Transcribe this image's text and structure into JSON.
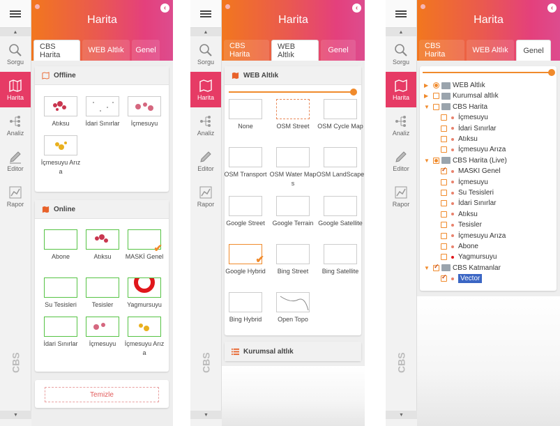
{
  "app": {
    "title": "Harita",
    "cbs_label": "CBS"
  },
  "sidebar": {
    "items": [
      {
        "label": "Sorgu",
        "icon": "search-icon"
      },
      {
        "label": "Harita",
        "icon": "map-icon"
      },
      {
        "label": "Analiz",
        "icon": "analysis-icon"
      },
      {
        "label": "Editor",
        "icon": "pencil-icon"
      },
      {
        "label": "Rapor",
        "icon": "chart-icon"
      }
    ]
  },
  "tabs": [
    "CBS Harita",
    "WEB Altlık",
    "Genel"
  ],
  "panel1": {
    "offline_title": "Offline",
    "offline_layers": [
      "Atıksu",
      "İdari Sınırlar",
      "İçmesuyu",
      "İçmesuyu Arıza"
    ],
    "online_title": "Online",
    "online_layers": [
      "Abone",
      "Atıksu",
      "MASKİ Genel",
      "Su Tesisleri",
      "Tesisler",
      "Yagmursuyu",
      "İdari Sınırlar",
      "İçmesuyu",
      "İçmesuyu Arıza"
    ],
    "clear_button": "Temizle"
  },
  "panel2": {
    "web_title": "WEB Altlık",
    "basemaps": [
      "None",
      "OSM Street",
      "OSM Cycle Map",
      "OSM Transport",
      "OSM Water Maps",
      "OSM LandScape",
      "Google Street",
      "Google Terrain",
      "Google Satellite",
      "Google Hybrid",
      "Bing Street",
      "Bing Satellite",
      "Bing Hybrid",
      "Open Topo"
    ],
    "kurumsal_title": "Kurumsal altlık"
  },
  "panel3": {
    "tree": [
      {
        "label": "WEB Altlık",
        "level": 0,
        "expand": "▶",
        "check": "radio"
      },
      {
        "label": "Kurumsal altlık",
        "level": 0,
        "expand": "▶",
        "check": "off"
      },
      {
        "label": "CBS Harita",
        "level": 0,
        "expand": "▼",
        "check": "off"
      },
      {
        "label": "İçmesuyu",
        "level": 1,
        "check": "off"
      },
      {
        "label": "İdari Sınırlar",
        "level": 1,
        "check": "off"
      },
      {
        "label": "Atıksu",
        "level": 1,
        "check": "off"
      },
      {
        "label": "İçmesuyu Arıza",
        "level": 1,
        "check": "off"
      },
      {
        "label": "CBS Harita (Live)",
        "level": 0,
        "expand": "▼",
        "check": "mid"
      },
      {
        "label": "MASKI Genel",
        "level": 1,
        "check": "on"
      },
      {
        "label": "İçmesuyu",
        "level": 1,
        "check": "off"
      },
      {
        "label": "Su Tesisleri",
        "level": 1,
        "check": "off"
      },
      {
        "label": "İdari Sınırlar",
        "level": 1,
        "check": "off"
      },
      {
        "label": "Atıksu",
        "level": 1,
        "check": "off"
      },
      {
        "label": "Tesisler",
        "level": 1,
        "check": "off"
      },
      {
        "label": "İçmesuyu Arıza",
        "level": 1,
        "check": "off"
      },
      {
        "label": "Abone",
        "level": 1,
        "check": "off"
      },
      {
        "label": "Yagmursuyu",
        "level": 1,
        "check": "off"
      },
      {
        "label": "CBS Katmanlar",
        "level": 0,
        "expand": "▼",
        "check": "on"
      },
      {
        "label": "Vector",
        "level": 1,
        "check": "on"
      }
    ]
  },
  "colors": {
    "accent": "#f08a2b",
    "active_sidebar": "#e63b65",
    "selected_node": "#3b66c4"
  }
}
